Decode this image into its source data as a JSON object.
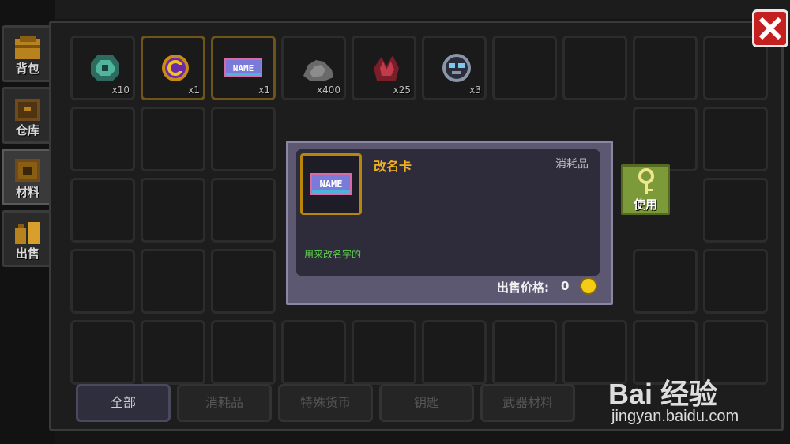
{
  "side_tabs": [
    {
      "label": "背包",
      "icon": "backpack-icon",
      "active": false
    },
    {
      "label": "仓库",
      "icon": "warehouse-icon",
      "active": false
    },
    {
      "label": "材料",
      "icon": "materials-icon",
      "active": true
    },
    {
      "label": "出售",
      "icon": "sell-icon",
      "active": false
    }
  ],
  "inventory": [
    {
      "icon": "gem-icon",
      "count": "x10"
    },
    {
      "icon": "coin-token-icon",
      "count": "x1"
    },
    {
      "icon": "name-card-icon",
      "count": "x1"
    },
    {
      "icon": "ore-icon",
      "count": "x400"
    },
    {
      "icon": "crystal-icon",
      "count": "x25"
    },
    {
      "icon": "helmet-icon",
      "count": "x3"
    }
  ],
  "category_tabs": [
    "全部",
    "消耗品",
    "特殊货币",
    "钥匙",
    "武器材料"
  ],
  "tooltip": {
    "name": "改名卡",
    "type": "消耗品",
    "icon_text": "NAME",
    "description": "用来改名字的",
    "price_label": "出售价格:",
    "price_value": "0"
  },
  "use_button": {
    "label": "使用"
  },
  "watermark": {
    "logo": "Bai  经验",
    "url": "jingyan.baidu.com"
  },
  "colors": {
    "accent_gold": "#f2b01e",
    "desc_green": "#5cd24a",
    "close_red": "#c42020",
    "use_green": "#7d9a3a"
  }
}
